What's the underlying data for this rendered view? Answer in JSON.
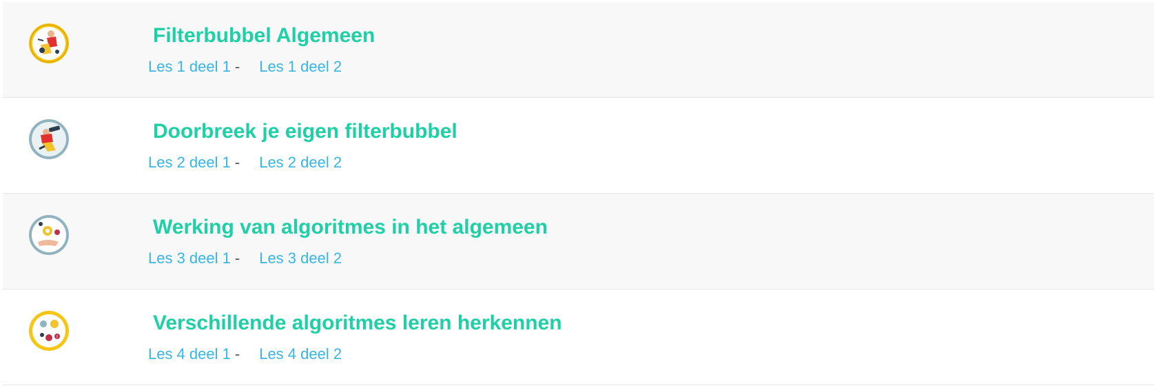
{
  "lessons": [
    {
      "icon": "person-searching-icon",
      "title": "Filterbubbel Algemeen",
      "links": [
        "Les 1 deel 1",
        "Les 1 deel 2"
      ],
      "separator": "-"
    },
    {
      "icon": "person-telescope-icon",
      "title": "Doorbreek je eigen filterbubbel",
      "links": [
        "Les 2 deel 1",
        "Les 2 deel 2"
      ],
      "separator": "-"
    },
    {
      "icon": "hand-gears-icon",
      "title": "Werking van algoritmes in het algemeen",
      "links": [
        "Les 3 deel 1",
        "Les 3 deel 2"
      ],
      "separator": "-"
    },
    {
      "icon": "algorithm-symbols-icon",
      "title": "Verschillende algoritmes leren herkennen",
      "links": [
        "Les 4 deel 1",
        "Les 4 deel 2"
      ],
      "separator": "-"
    }
  ],
  "colors": {
    "title": "#1fcfa6",
    "link": "#37b5e3",
    "row_shaded": "#f8f8f8",
    "icon_ring_yellow": "#f5c518",
    "icon_ring_grey": "#8fb3bf"
  }
}
